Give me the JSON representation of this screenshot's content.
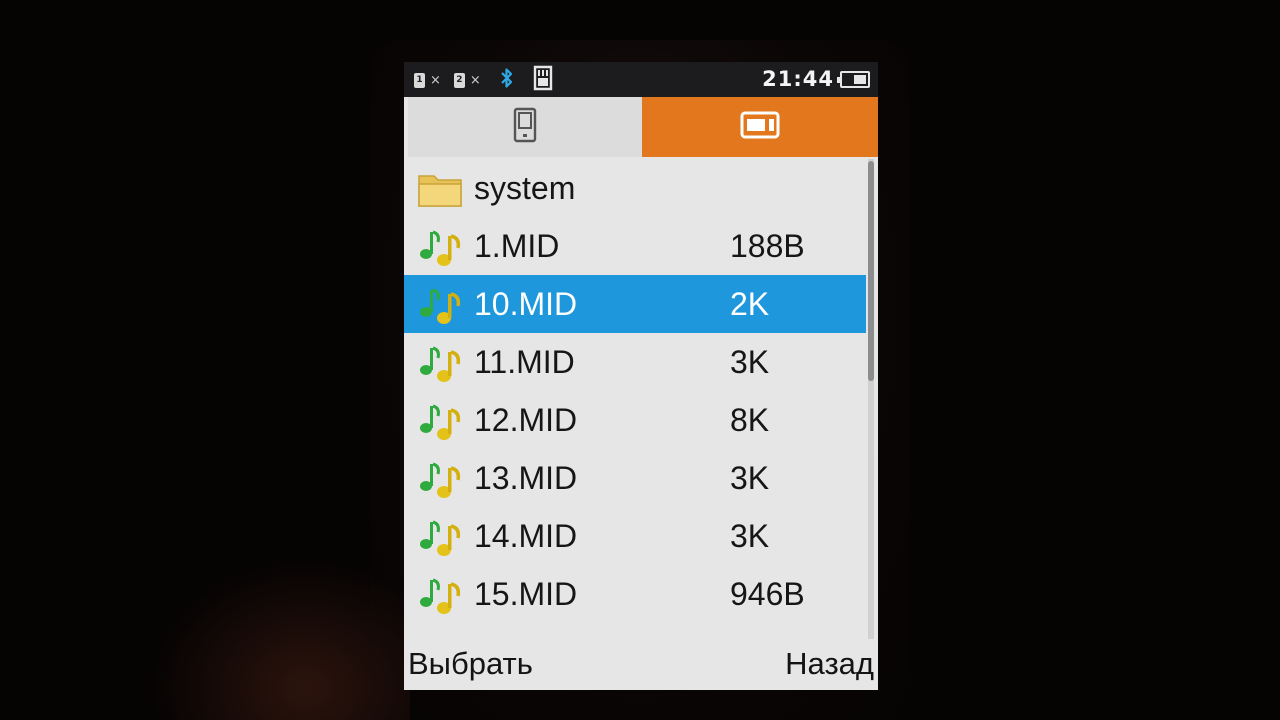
{
  "statusbar": {
    "sim1_label": "1",
    "sim2_label": "2",
    "sim_off_mark": "×",
    "bluetooth_icon": "bluetooth-icon",
    "time": "21:44"
  },
  "tabs": [
    {
      "name": "phone-storage",
      "icon": "phone-icon",
      "selected": false
    },
    {
      "name": "memory-card",
      "icon": "memory-card-icon",
      "selected": true
    }
  ],
  "files": [
    {
      "name": "system",
      "size": "",
      "type": "folder"
    },
    {
      "name": "1.MID",
      "size": "188B",
      "type": "music"
    },
    {
      "name": "10.MID",
      "size": "2K",
      "type": "music",
      "selected": true
    },
    {
      "name": "11.MID",
      "size": "3K",
      "type": "music"
    },
    {
      "name": "12.MID",
      "size": "8K",
      "type": "music"
    },
    {
      "name": "13.MID",
      "size": "3K",
      "type": "music"
    },
    {
      "name": "14.MID",
      "size": "3K",
      "type": "music"
    },
    {
      "name": "15.MID",
      "size": "946B",
      "type": "music"
    }
  ],
  "softkeys": {
    "left": "Выбрать",
    "right": "Назад"
  },
  "colors": {
    "accent_tab": "#e2771e",
    "selection": "#1f97dc",
    "bluetooth": "#2fa8e6"
  }
}
